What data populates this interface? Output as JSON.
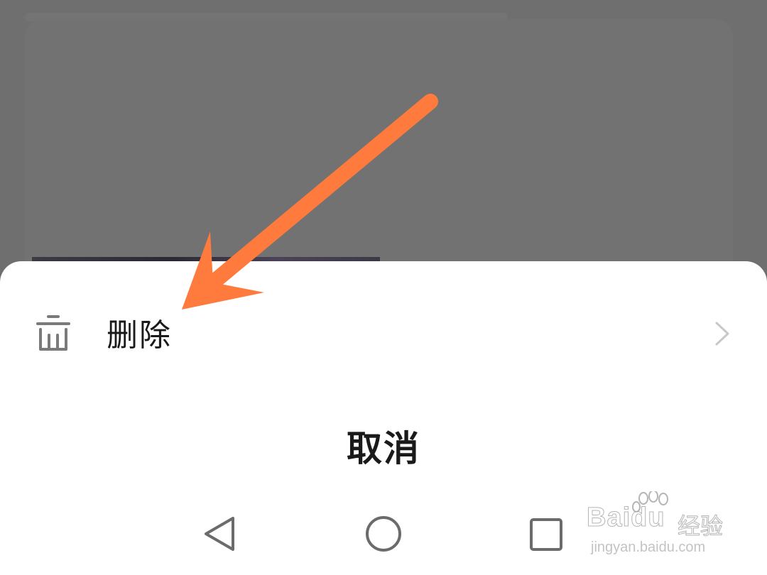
{
  "sheet": {
    "items": [
      {
        "label": "删除",
        "icon": "trash-icon",
        "has_chevron": true
      }
    ],
    "cancel_label": "取消"
  },
  "navbar": {
    "buttons": [
      "back-icon",
      "home-icon",
      "recents-icon"
    ]
  },
  "watermark": {
    "brand": "Bai",
    "brand_suffix": "du",
    "product": "经验",
    "url": "jingyan.baidu.com"
  },
  "colors": {
    "scrim": "#6f6f6f",
    "sheet": "#ffffff",
    "text": "#1a1a1a",
    "icon": "#7a7a7a",
    "arrow": "#ff7a3d"
  }
}
